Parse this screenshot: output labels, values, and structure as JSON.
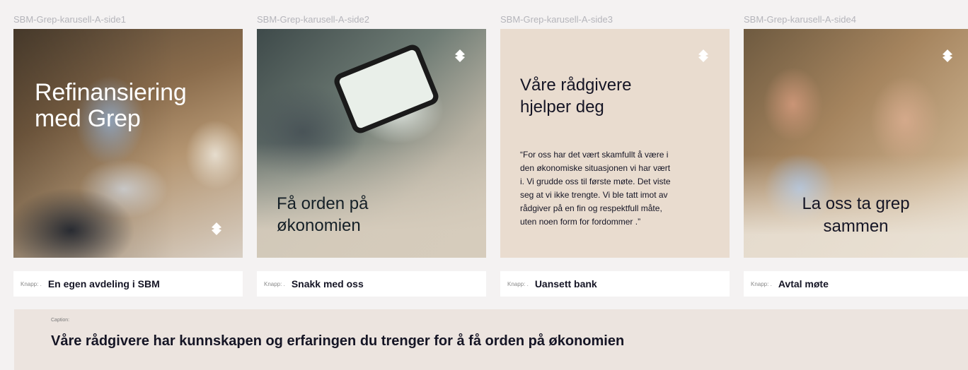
{
  "frames": [
    {
      "label": "SBM-Grep-karusell-A-side1",
      "title_lines": [
        "Refinansiering",
        "med Grep"
      ],
      "button_prefix": "Knapp: .",
      "button_text": "En egen avdeling i SBM"
    },
    {
      "label": "SBM-Grep-karusell-A-side2",
      "title_lines": [
        "Få orden på",
        "økonomien"
      ],
      "button_prefix": "Knapp: .",
      "button_text": "Snakk med oss"
    },
    {
      "label": "SBM-Grep-karusell-A-side3",
      "title_lines": [
        "Våre rådgivere",
        "hjelper deg"
      ],
      "quote_lines": [
        "“For oss har det vært skamfullt å være i",
        "den økonomiske situasjonen vi har vært",
        "i. Vi grudde oss til første møte. Det viste",
        "seg at vi ikke trengte. Vi ble tatt imot av",
        "rådgiver på en fin og respektfull måte,",
        "uten noen form for fordommer .”"
      ],
      "button_prefix": "Knapp: .",
      "button_text": "Uansett bank"
    },
    {
      "label": "SBM-Grep-karusell-A-side4",
      "title_lines": [
        "La oss ta grep",
        "sammen"
      ],
      "button_prefix": "Knapp: .",
      "button_text": "Avtal møte"
    }
  ],
  "caption": {
    "label": "Caption:",
    "text": "Våre rådgivere har kunnskapen og erfaringen du trenger for å få orden på økonomien"
  },
  "icons": {
    "brand_logo": "grep-diamond-logo-icon"
  },
  "colors": {
    "page_background": "#f4f2f2",
    "caption_background": "#ece4df",
    "quote_slide_background": "#e9dccf",
    "dark_text": "#151525",
    "label_gray": "#b5b5bb"
  }
}
